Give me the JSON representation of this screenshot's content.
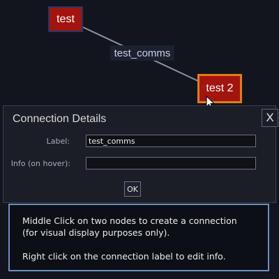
{
  "graph": {
    "nodes": [
      {
        "label": "test"
      },
      {
        "label": "test 2"
      }
    ],
    "connection": {
      "label": "test_comms"
    }
  },
  "dialog": {
    "title": "Connection Details",
    "close_label": "X",
    "label_field": {
      "label": "Label:",
      "value": "test_comms"
    },
    "info_field": {
      "label": "Info (on hover):",
      "value": ""
    },
    "ok_label": "OK"
  },
  "help": {
    "line1": "Middle Click on two nodes to create a connection",
    "line2": "(for visual display purposes only).",
    "line3": "Right click on the connection label to edit info."
  },
  "colors": {
    "background": "#12151d",
    "node_fill": "#a3140f",
    "selected_border": "#e07f10",
    "help_border": "#6e8fc0"
  }
}
